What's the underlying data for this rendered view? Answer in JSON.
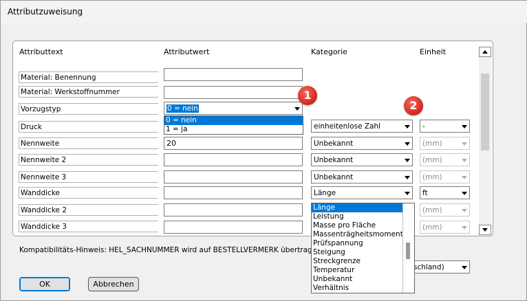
{
  "window": {
    "title": "Attributzuweisung"
  },
  "headers": {
    "attributtext": "Attributtext",
    "attributwert": "Attributwert",
    "kategorie": "Kategorie",
    "einheit": "Einheit"
  },
  "rows": [
    {
      "label": "Material: Benennung",
      "value": ""
    },
    {
      "label": "Material: Werkstoffnummer",
      "value": ""
    },
    {
      "label": "Vorzugstyp",
      "value": "0 = nein"
    },
    {
      "label": "Druck",
      "value": "",
      "kategorie": "einheitenlose Zahl",
      "einheit": "-"
    },
    {
      "label": "Nennweite",
      "value": "20",
      "kategorie": "Unbekannt",
      "einheit": "(mm)"
    },
    {
      "label": "Nennweite 2",
      "value": "",
      "kategorie": "Unbekannt",
      "einheit": "(mm)"
    },
    {
      "label": "Nennweite 3",
      "value": "",
      "kategorie": "Unbekannt",
      "einheit": "(mm)"
    },
    {
      "label": "Wanddicke",
      "value": "",
      "kategorie": "Länge",
      "einheit": "ft"
    },
    {
      "label": "Wanddicke 2",
      "value": "",
      "kategorie": "",
      "einheit": "(mm)"
    },
    {
      "label": "Wanddicke 3",
      "value": "",
      "kategorie": "",
      "einheit": "(mm)"
    }
  ],
  "vorzugstyp_options": [
    "0 = nein",
    "1 = ja"
  ],
  "kategorie_options": [
    "Länge",
    "Leistung",
    "Masse pro Fläche",
    "Massenträgheitsmoment",
    "Prüfspannung",
    "Steigung",
    "Streckgrenze",
    "Temperatur",
    "Unbekannt",
    "Verhältnis"
  ],
  "badges": [
    "1",
    "2"
  ],
  "hint": "Kompatibilitäts-Hinweis: HEL_SACHNUMMER wird auf BESTELLVERMERK übertragen.",
  "region_select": "schland)",
  "buttons": {
    "ok": "OK",
    "cancel": "Abbrechen"
  },
  "colors": {
    "badge": "#d4241a",
    "selection": "#0078d7"
  }
}
